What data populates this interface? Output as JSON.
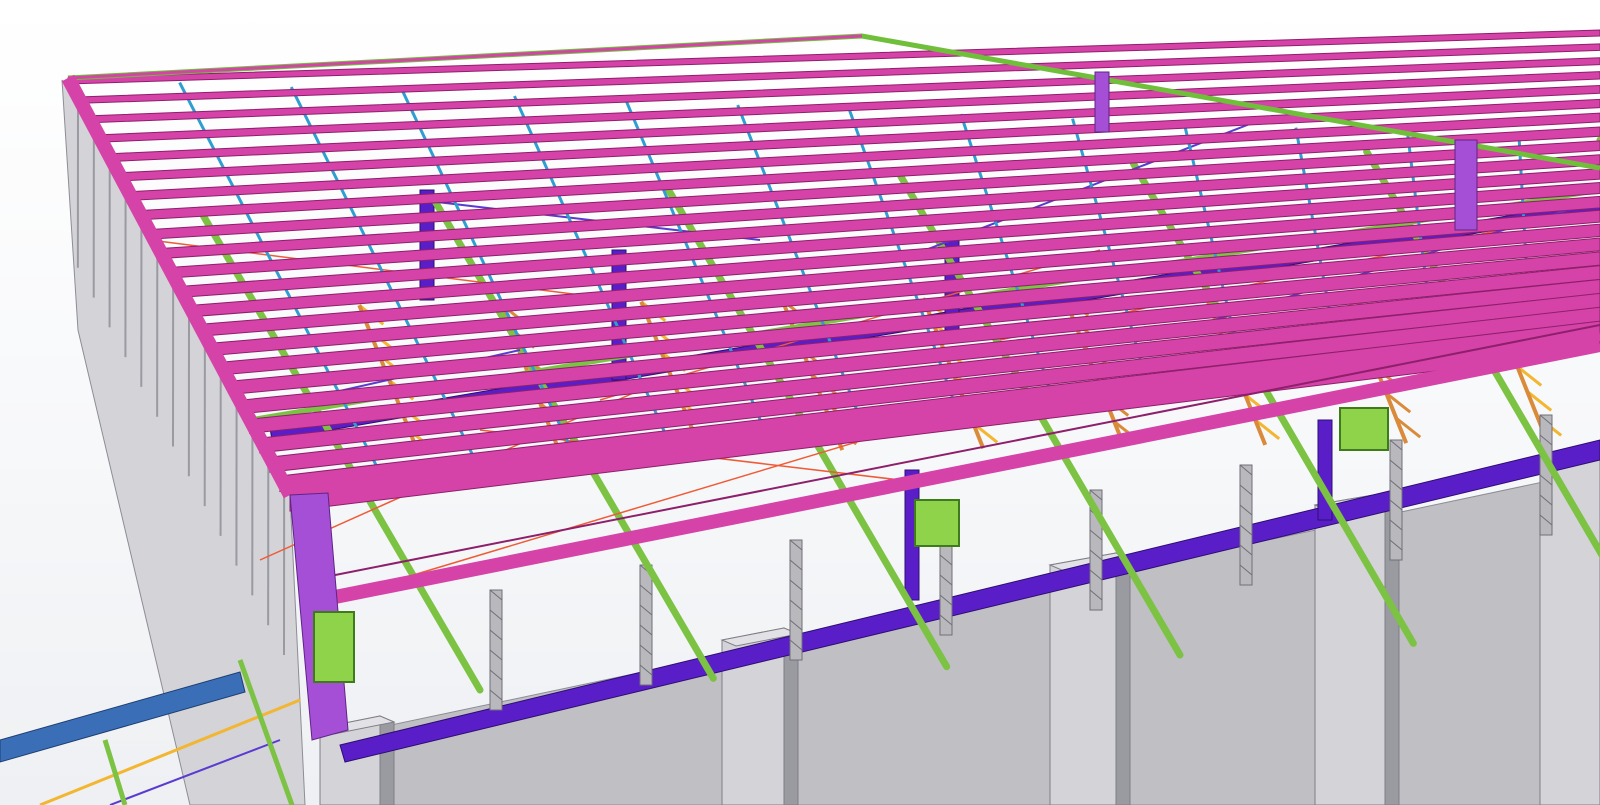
{
  "viewport": {
    "label": "3D model view",
    "background": "#ffffff"
  },
  "model": {
    "colors": {
      "rafter": "#d543a8",
      "rafter_edge": "#8e1f6b",
      "purlin": "#2f9ed0",
      "truss_chord": "#7cc243",
      "truss_web": "#f2b630",
      "truss_web_lower": "#d98b3a",
      "girder": "#5a1ec8",
      "column_steel": "#a44fd6",
      "concrete": "#bfbfc4",
      "concrete_dark": "#9a9aa1",
      "concrete_light": "#d3d3d8",
      "bracing": "#f05a36",
      "cross_bracing": "#5a3ad0",
      "joist_grey": "#b8b8bd",
      "connection_plate": "#8fd34b",
      "edge_beam": "#6fbf3a",
      "dark_beam": "#3a6fb8"
    }
  }
}
